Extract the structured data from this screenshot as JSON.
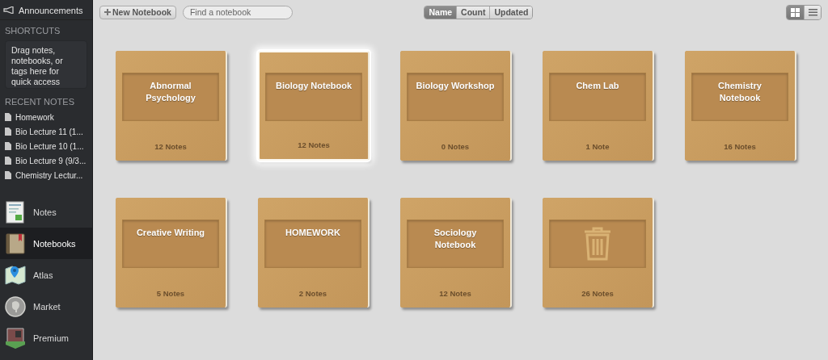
{
  "sidebar": {
    "announcements": "Announcements",
    "shortcuts": {
      "heading": "SHORTCUTS",
      "hint": "Drag notes, notebooks, or tags here for quick access"
    },
    "recent_notes": {
      "heading": "RECENT NOTES",
      "items": [
        "Homework",
        "Bio Lecture 11 (1...",
        "Bio Lecture 10 (1...",
        "Bio Lecture 9 (9/3...",
        "Chemistry Lectur..."
      ]
    },
    "nav": [
      {
        "label": "Notes",
        "kind": "notes",
        "selected": false
      },
      {
        "label": "Notebooks",
        "kind": "notebooks",
        "selected": true
      },
      {
        "label": "Atlas",
        "kind": "atlas",
        "selected": false
      },
      {
        "label": "Market",
        "kind": "market",
        "selected": false
      },
      {
        "label": "Premium",
        "kind": "premium",
        "selected": false
      }
    ]
  },
  "toolbar": {
    "new_button": "New Notebook",
    "search": {
      "placeholder": "Find a notebook"
    },
    "sort": [
      {
        "label": "Name",
        "selected": true
      },
      {
        "label": "Count",
        "selected": false
      },
      {
        "label": "Updated",
        "selected": false
      }
    ],
    "view": [
      {
        "kind": "grid",
        "selected": true
      },
      {
        "kind": "list",
        "selected": false
      }
    ]
  },
  "notebooks": [
    {
      "kind": "notebook",
      "title": "Abnormal Psychology",
      "count": "12 Notes",
      "selected": false
    },
    {
      "kind": "notebook",
      "title": "Biology Notebook",
      "count": "12 Notes",
      "selected": true
    },
    {
      "kind": "notebook",
      "title": "Biology Workshop",
      "count": "0 Notes",
      "selected": false
    },
    {
      "kind": "notebook",
      "title": "Chem Lab",
      "count": "1 Note",
      "selected": false
    },
    {
      "kind": "notebook",
      "title": "Chemistry Notebook",
      "count": "16 Notes",
      "selected": false
    },
    {
      "kind": "notebook",
      "title": "Creative Writing",
      "count": "5 Notes",
      "selected": false
    },
    {
      "kind": "notebook",
      "title": "HOMEWORK",
      "count": "2 Notes",
      "selected": false
    },
    {
      "kind": "notebook",
      "title": "Sociology Notebook",
      "count": "12 Notes",
      "selected": false
    },
    {
      "kind": "trash",
      "count": "26 Notes",
      "selected": false
    }
  ]
}
